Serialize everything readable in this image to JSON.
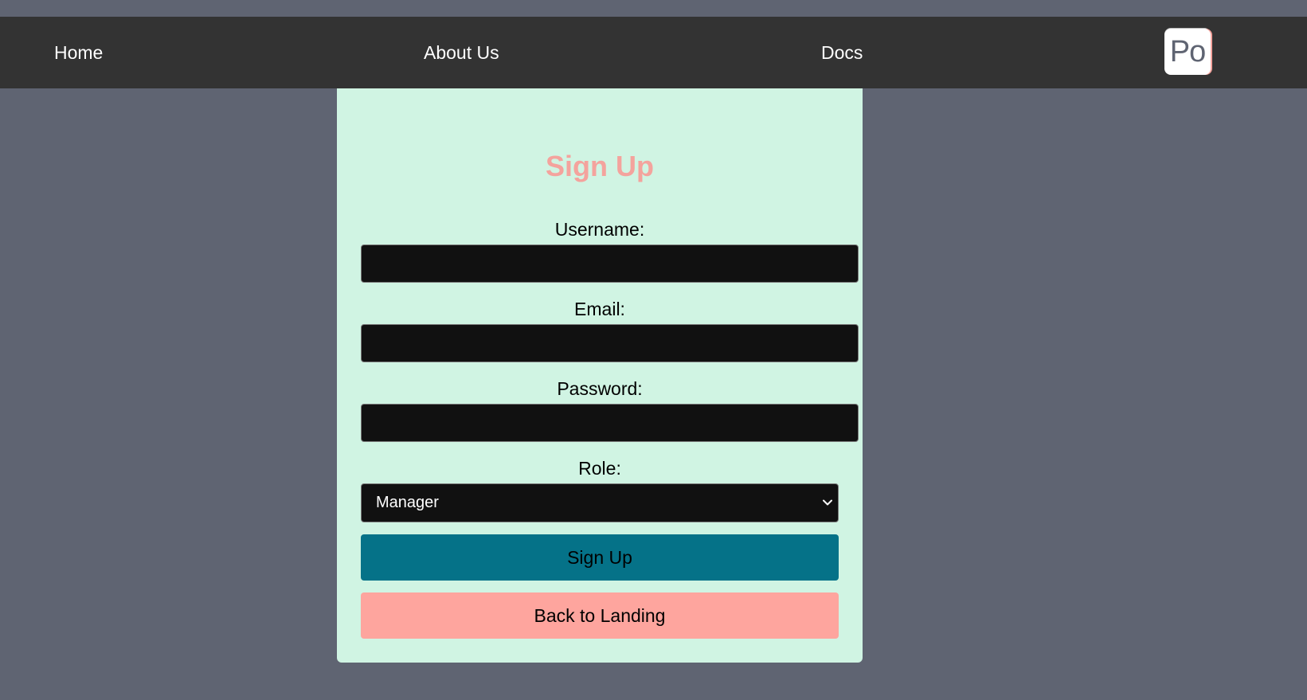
{
  "nav": {
    "home_label": "Home",
    "about_label": "About Us",
    "docs_label": "Docs",
    "logo_text": "Po"
  },
  "form": {
    "title": "Sign Up",
    "username_label": "Username:",
    "username_value": "",
    "email_label": "Email:",
    "email_value": "",
    "password_label": "Password:",
    "password_value": "",
    "role_label": "Role:",
    "role_selected": "Manager",
    "submit_label": "Sign Up",
    "back_label": "Back to Landing"
  },
  "colors": {
    "page_background": "#5f6472",
    "navbar_background": "#333333",
    "card_background": "#d0f4e3",
    "title_color": "#f4a39d",
    "input_background": "#111111",
    "submit_button": "#057288",
    "back_button": "#fea59e"
  },
  "icons": {
    "select_arrow": "chevron-down-icon",
    "logo": "logo-icon"
  }
}
